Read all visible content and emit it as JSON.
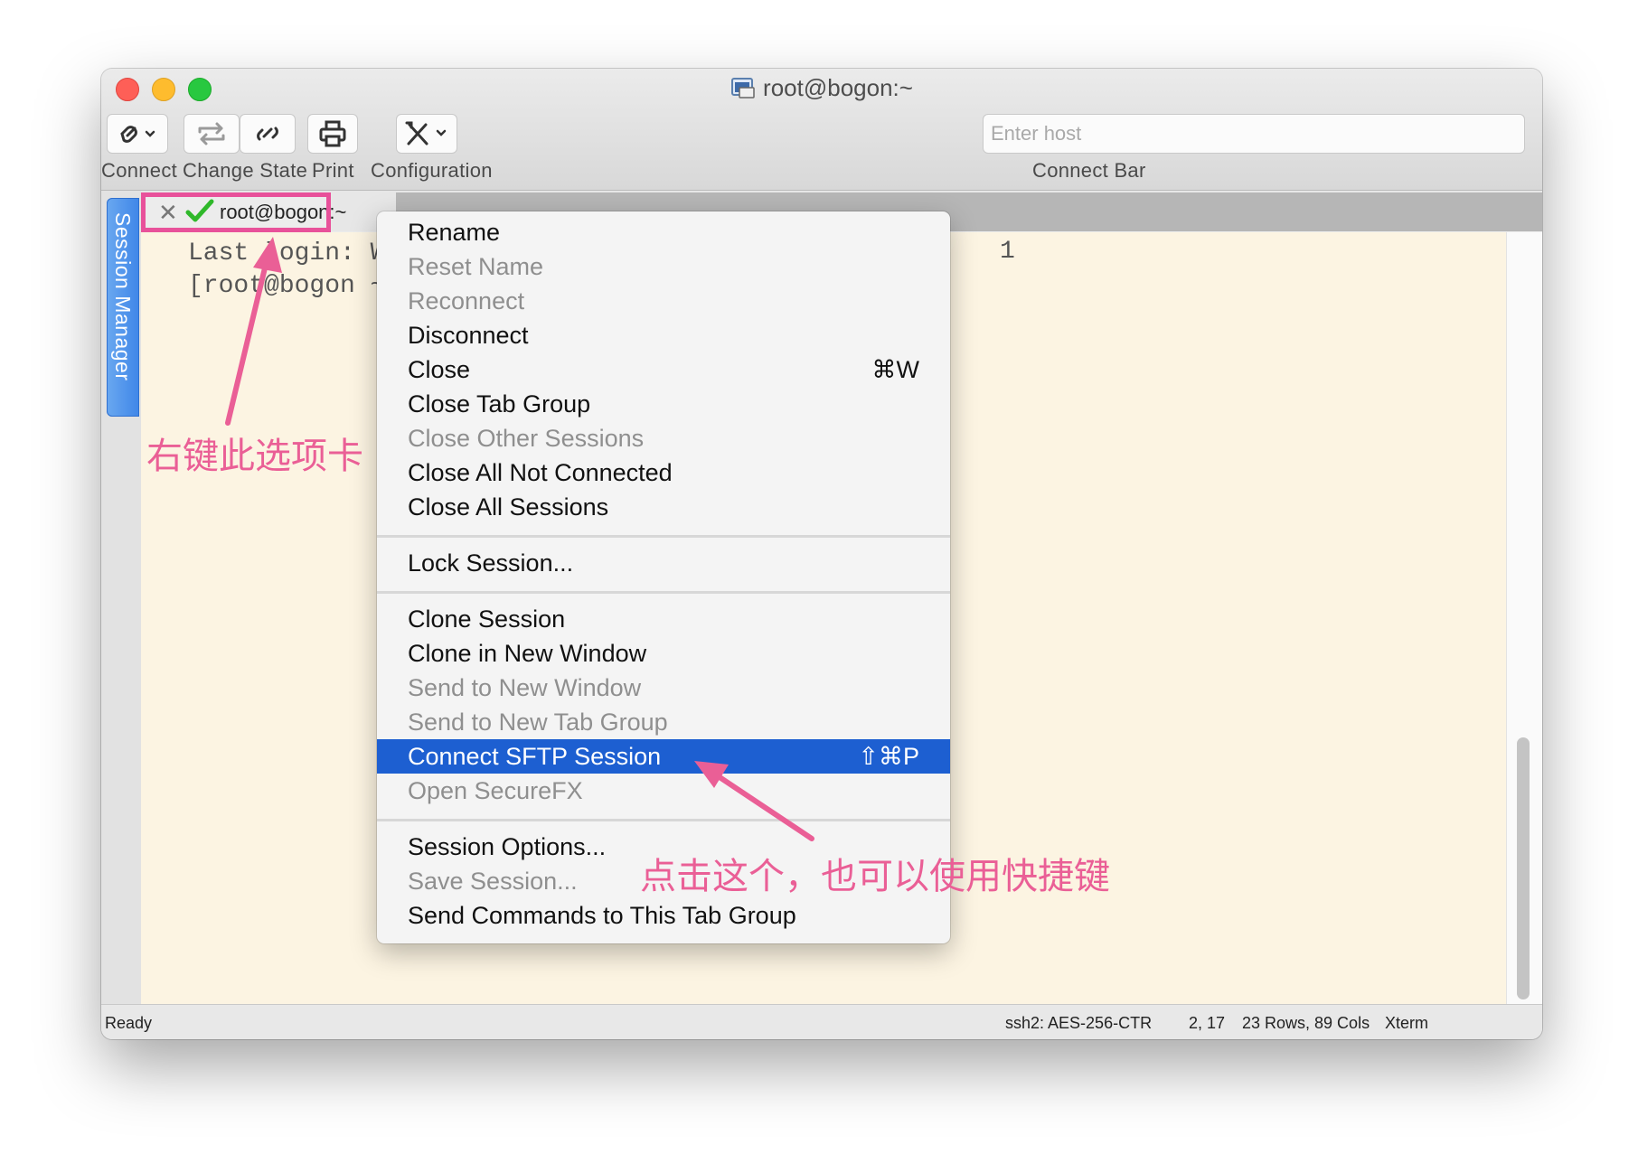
{
  "window": {
    "title": "root@bogon:~"
  },
  "toolbar": {
    "connect_label": "Connect",
    "change_state_label": "Change State",
    "print_label": "Print",
    "configuration_label": "Configuration",
    "connect_bar_label": "Connect Bar",
    "host_placeholder": "Enter host"
  },
  "sidebar": {
    "session_manager_label": "Session Manager"
  },
  "tab": {
    "label": "root@bogon:~",
    "close_glyph": "✕"
  },
  "terminal": {
    "line1": "Last login: Wed",
    "line2": "[root@bogon ~]#",
    "line1_tail": "1"
  },
  "context_menu": {
    "group1": [
      {
        "label": "Rename",
        "enabled": true
      },
      {
        "label": "Reset Name",
        "enabled": false
      },
      {
        "label": "Reconnect",
        "enabled": false
      },
      {
        "label": "Disconnect",
        "enabled": true
      },
      {
        "label": "Close",
        "shortcut": "⌘W",
        "enabled": true
      },
      {
        "label": "Close Tab Group",
        "enabled": true
      },
      {
        "label": "Close Other Sessions",
        "enabled": false
      },
      {
        "label": "Close All Not Connected",
        "enabled": true
      },
      {
        "label": "Close All Sessions",
        "enabled": true
      }
    ],
    "group2": [
      {
        "label": "Lock Session...",
        "enabled": true
      }
    ],
    "group3": [
      {
        "label": "Clone Session",
        "enabled": true
      },
      {
        "label": "Clone in New Window",
        "enabled": true
      },
      {
        "label": "Send to New Window",
        "enabled": false
      },
      {
        "label": "Send to New Tab Group",
        "enabled": false
      },
      {
        "label": "Connect SFTP Session",
        "shortcut": "⇧⌘P",
        "enabled": true,
        "selected": true
      },
      {
        "label": "Open SecureFX",
        "enabled": false
      }
    ],
    "group4": [
      {
        "label": "Session Options...",
        "enabled": true
      },
      {
        "label": "Save Session...",
        "enabled": false
      },
      {
        "label": "Send Commands to This Tab Group",
        "enabled": true
      }
    ]
  },
  "statusbar": {
    "status": "Ready",
    "cipher": "ssh2: AES-256-CTR",
    "cursor": "2, 17",
    "size": "23 Rows, 89 Cols",
    "terminal_type": "Xterm"
  },
  "annotations": {
    "tab_hint": "右键此选项卡",
    "menu_hint": "点击这个，也可以使用快捷键"
  },
  "colors": {
    "annotation": "#ea5f96",
    "selection": "#1d5fd1",
    "terminal_bg": "#fcf4e2"
  },
  "icons": [
    "connect-link-icon",
    "change-state-icon",
    "reconnect-link-icon",
    "print-icon",
    "configuration-tools-icon",
    "connected-check-icon",
    "close-tab-icon",
    "terminal-app-icon"
  ]
}
